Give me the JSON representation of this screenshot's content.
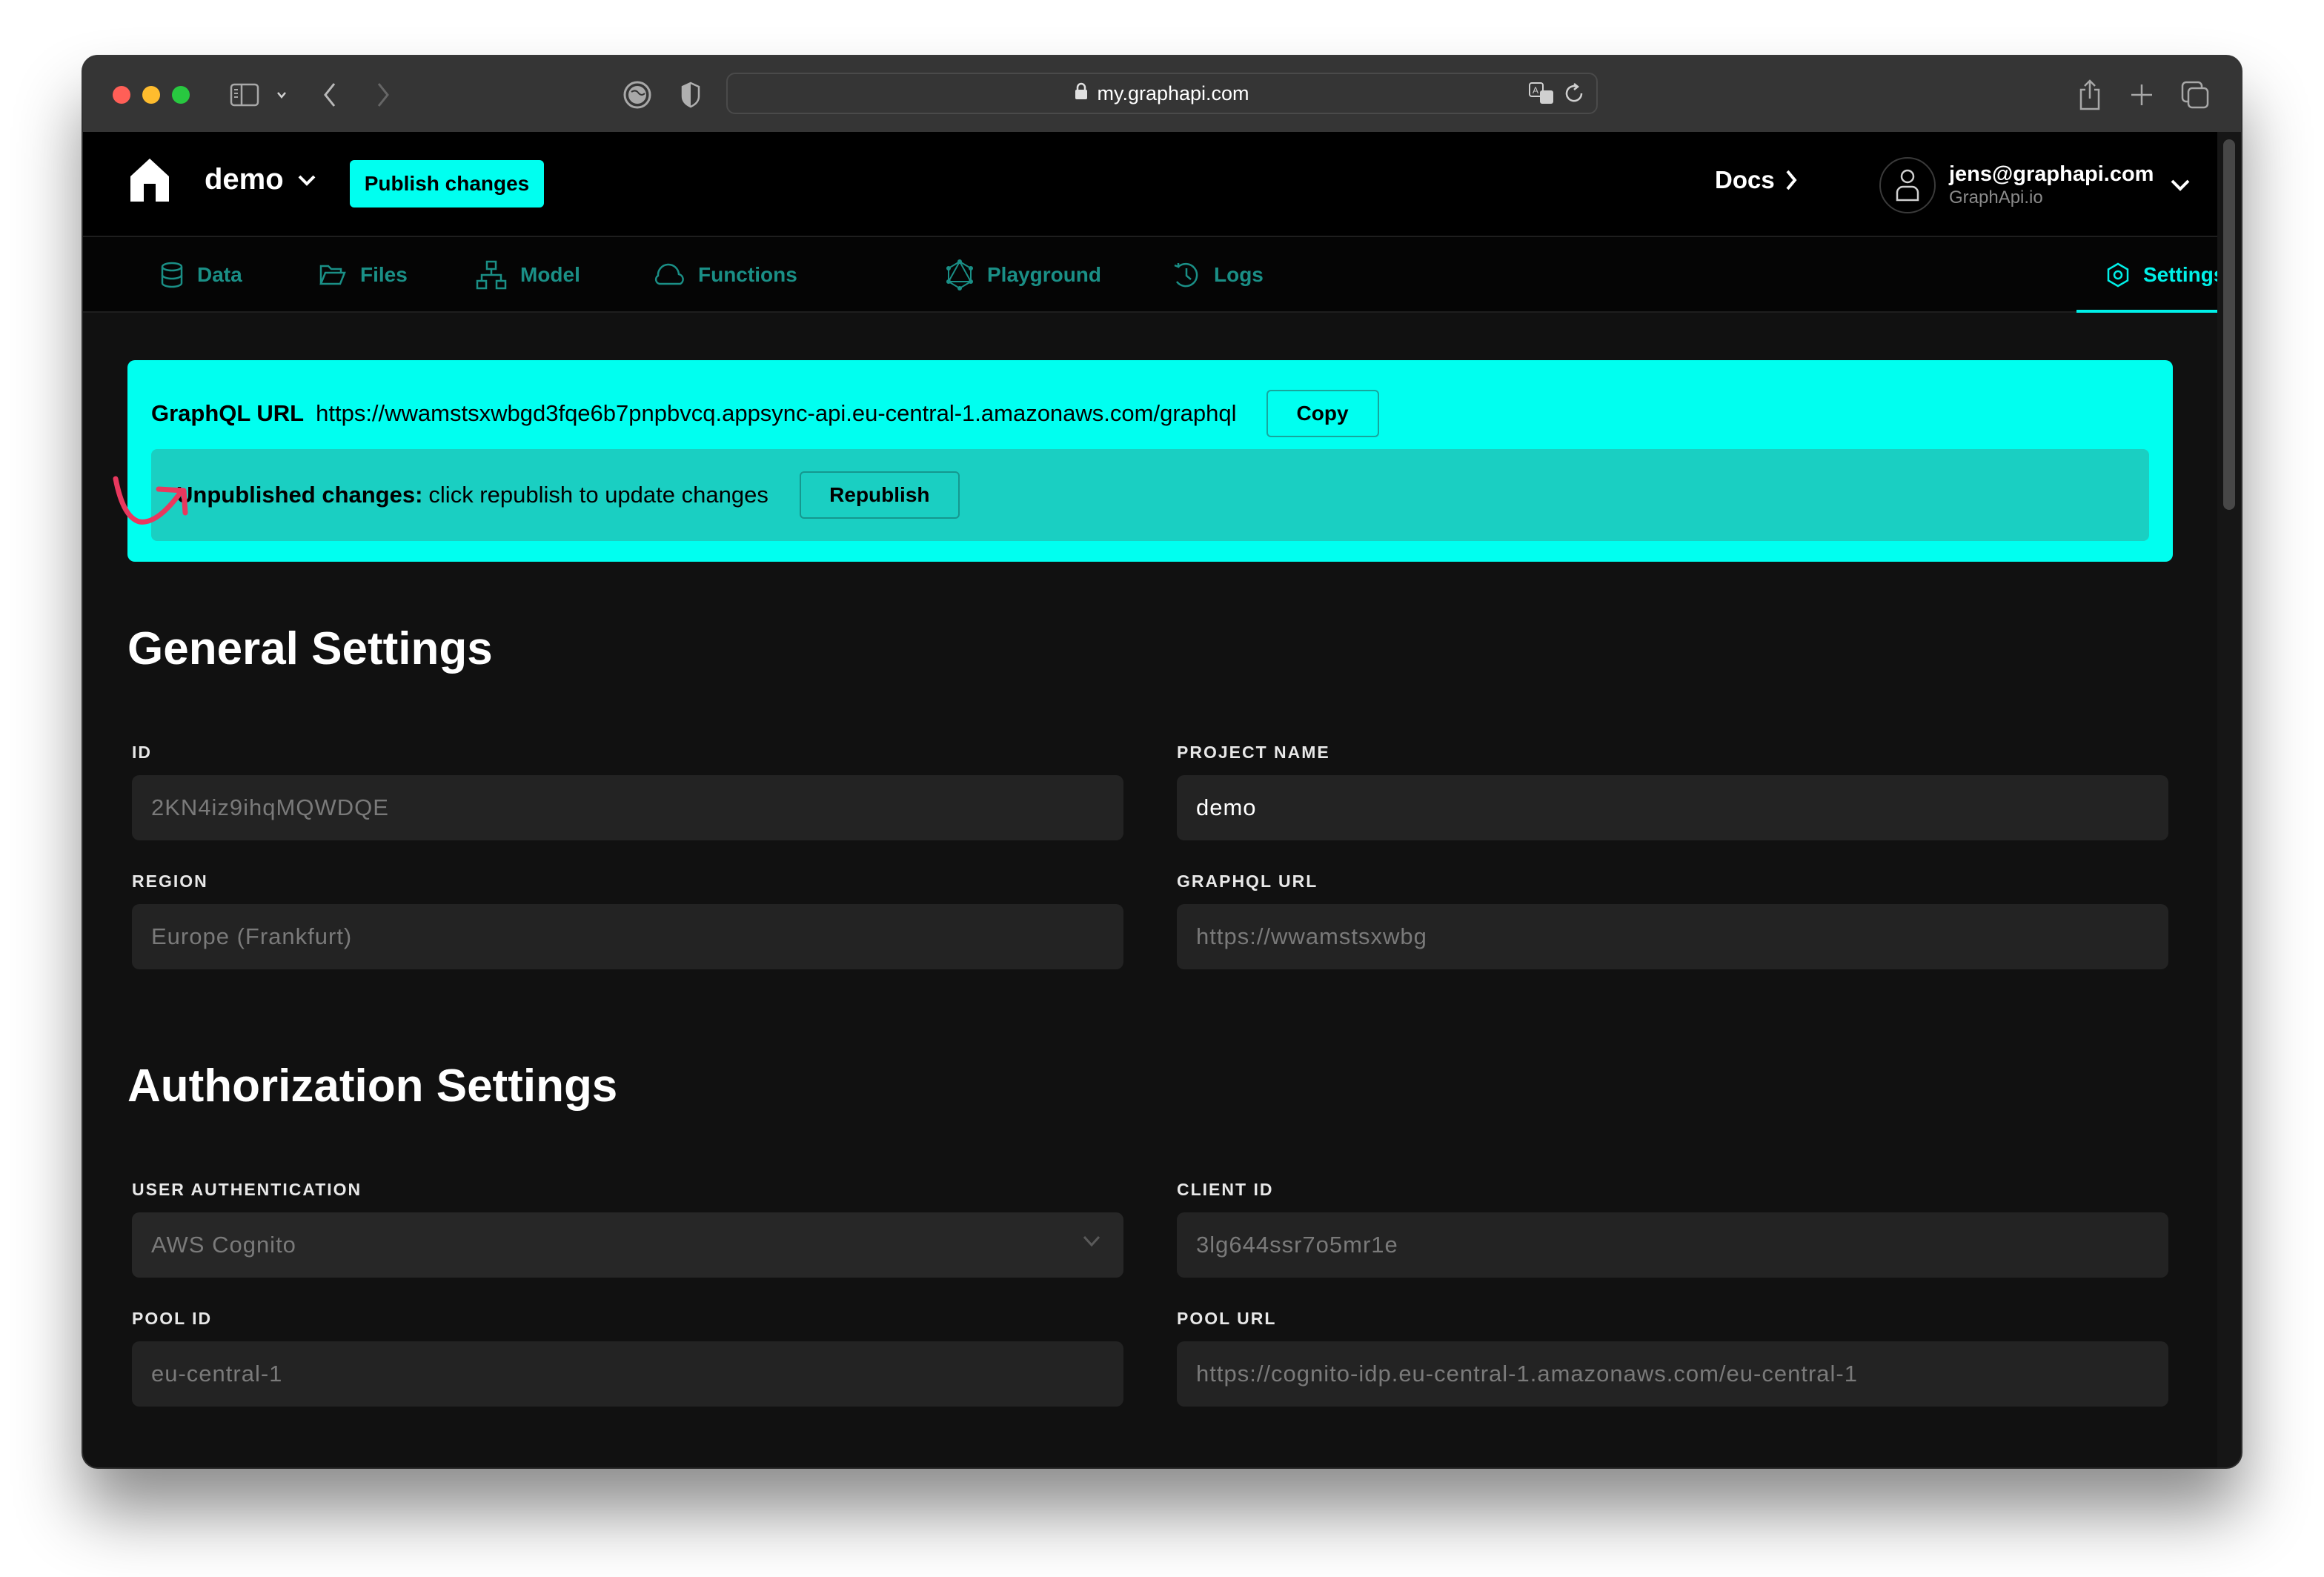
{
  "browser": {
    "url": "my.graphapi.com"
  },
  "header": {
    "project_name": "demo",
    "publish_label": "Publish changes",
    "docs_label": "Docs",
    "user_email": "jens@graphapi.com",
    "user_org": "GraphApi.io"
  },
  "nav": {
    "items": [
      {
        "label": "Data",
        "icon": "database-icon"
      },
      {
        "label": "Files",
        "icon": "folder-icon"
      },
      {
        "label": "Model",
        "icon": "hierarchy-icon"
      },
      {
        "label": "Functions",
        "icon": "cloud-icon"
      },
      {
        "label": "Playground",
        "icon": "graphql-icon"
      },
      {
        "label": "Logs",
        "icon": "history-icon"
      }
    ],
    "active": {
      "label": "Settings",
      "icon": "settings-hex-icon"
    }
  },
  "banner": {
    "url_label": "GraphQL URL",
    "url_value": "https://wwamstsxwbgd3fqe6b7pnpbvcq.appsync-api.eu-central-1.amazonaws.com/graphql",
    "copy_label": "Copy",
    "unpublished_label": "Unpublished changes:",
    "unpublished_text": "click republish to update changes",
    "republish_label": "Republish"
  },
  "general": {
    "title": "General Settings",
    "id_label": "ID",
    "id_value": "2KN4iz9ihqMQWDQE",
    "project_name_label": "PROJECT NAME",
    "project_name_value": "demo",
    "region_label": "REGION",
    "region_value": "Europe (Frankfurt)",
    "graphql_url_label": "GRAPHQL URL",
    "graphql_url_value": "https://wwamstsxwbg"
  },
  "auth": {
    "title": "Authorization Settings",
    "user_auth_label": "USER AUTHENTICATION",
    "user_auth_value": "AWS Cognito",
    "client_id_label": "CLIENT ID",
    "client_id_value": "3lg644ssr7o5mr1e",
    "pool_id_label": "POOL ID",
    "pool_id_value": "eu-central-1",
    "pool_url_label": "POOL URL",
    "pool_url_value": "https://cognito-idp.eu-central-1.amazonaws.com/eu-central-1"
  },
  "colors": {
    "accent": "#00fff0",
    "banner_inner": "#1acfc2",
    "nav_inactive": "#1a8f86",
    "annotation": "#e8385e"
  }
}
